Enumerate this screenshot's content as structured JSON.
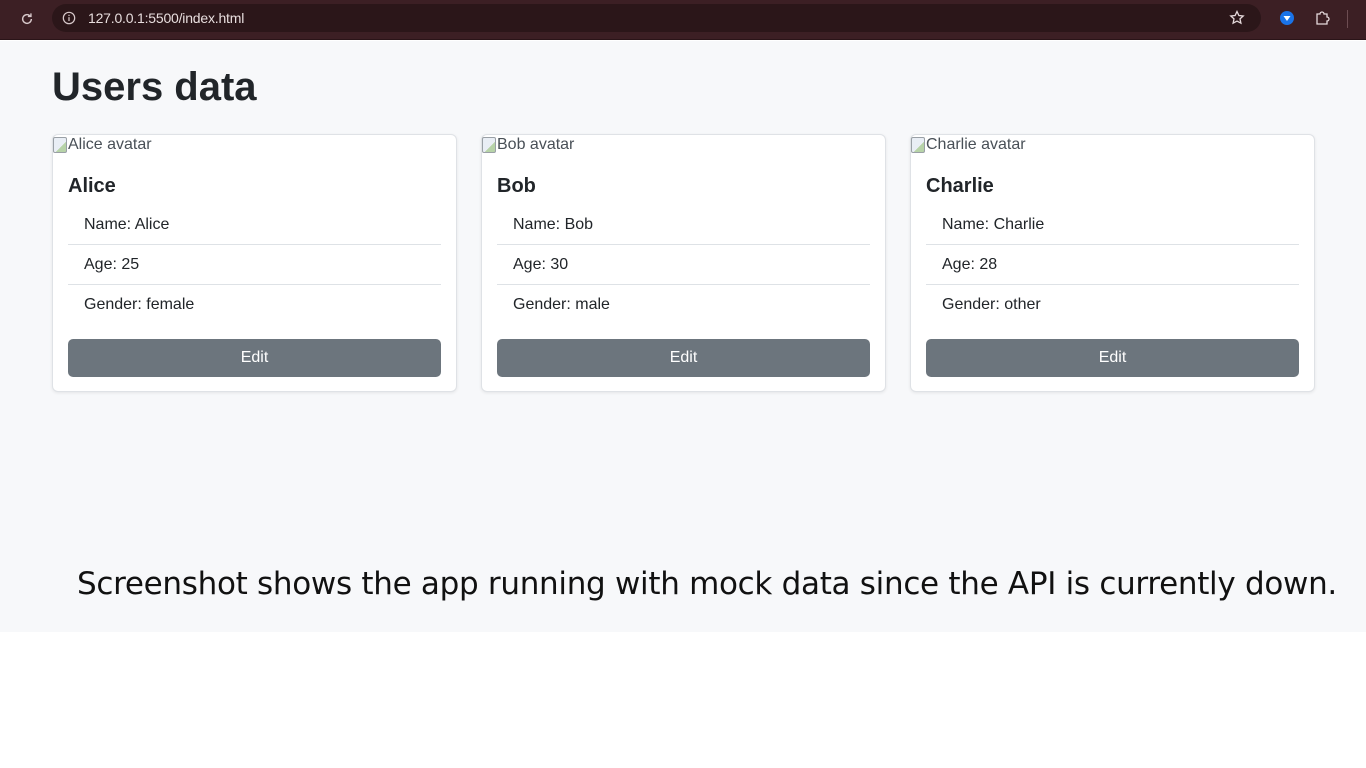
{
  "browser": {
    "url": "127.0.0.1:5500/index.html"
  },
  "page": {
    "title": "Users data"
  },
  "users": [
    {
      "avatar_alt": "Alice avatar",
      "heading": "Alice",
      "name_line": "Name: Alice",
      "age_line": "Age: 25",
      "gender_line": "Gender: female",
      "edit_label": "Edit"
    },
    {
      "avatar_alt": "Bob avatar",
      "heading": "Bob",
      "name_line": "Name: Bob",
      "age_line": "Age: 30",
      "gender_line": "Gender: male",
      "edit_label": "Edit"
    },
    {
      "avatar_alt": "Charlie avatar",
      "heading": "Charlie",
      "name_line": "Name: Charlie",
      "age_line": "Age: 28",
      "gender_line": "Gender: other",
      "edit_label": "Edit"
    }
  ],
  "caption": "Screenshot shows the app running with mock data since the API is currently down.",
  "colors": {
    "browser_bar": "#3c1f24",
    "page_background": "#f7f8fa",
    "button": "#6c757d"
  },
  "icons": {
    "reload": "reload-icon",
    "info": "info-icon",
    "star": "star-icon",
    "extension": "extension-icon",
    "puzzle": "puzzle-icon",
    "broken_image": "broken-image-icon"
  }
}
